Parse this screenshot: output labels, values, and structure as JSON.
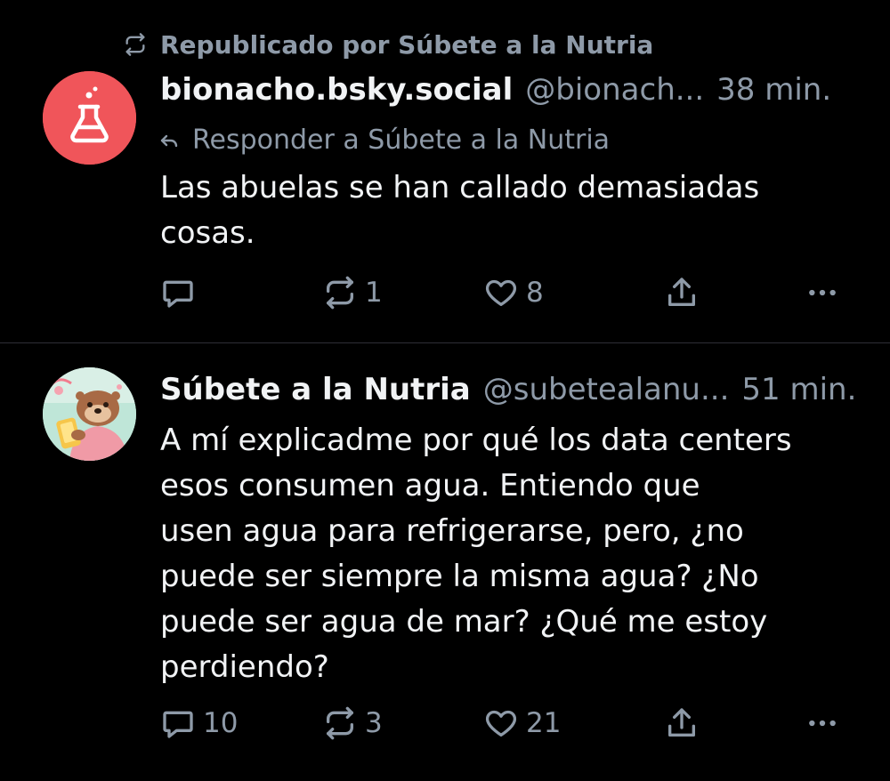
{
  "colors": {
    "background": "#000000",
    "text": "#f1f3f5",
    "muted": "#8e9aa8",
    "divider": "#2e2f36",
    "avatar1": "#f0555a"
  },
  "posts": [
    {
      "repost_label": "Republicado por Súbete a la Nutria",
      "display_name": "bionacho.bsky.social",
      "handle": "@bionach...",
      "time": "38 min.",
      "reply_to": "Responder a Súbete a la Nutria",
      "text": "Las abuelas se han callado demasiadas\ncosas.",
      "avatar_icon": "flask-icon",
      "counts": {
        "replies": "",
        "reposts": "1",
        "likes": "8"
      }
    },
    {
      "display_name": "Súbete a la Nutria",
      "handle": "@subetealanu...",
      "time": "51 min.",
      "text": "A mí explicadme por qué los data centers\nesos consumen agua. Entiendo que\nusen agua para refrigerarse, pero, ¿no\npuede ser siempre la misma agua? ¿No\npuede ser agua de mar? ¿Qué me estoy\nperdiendo?",
      "avatar_icon": "otter-avatar",
      "counts": {
        "replies": "10",
        "reposts": "3",
        "likes": "21"
      }
    }
  ]
}
